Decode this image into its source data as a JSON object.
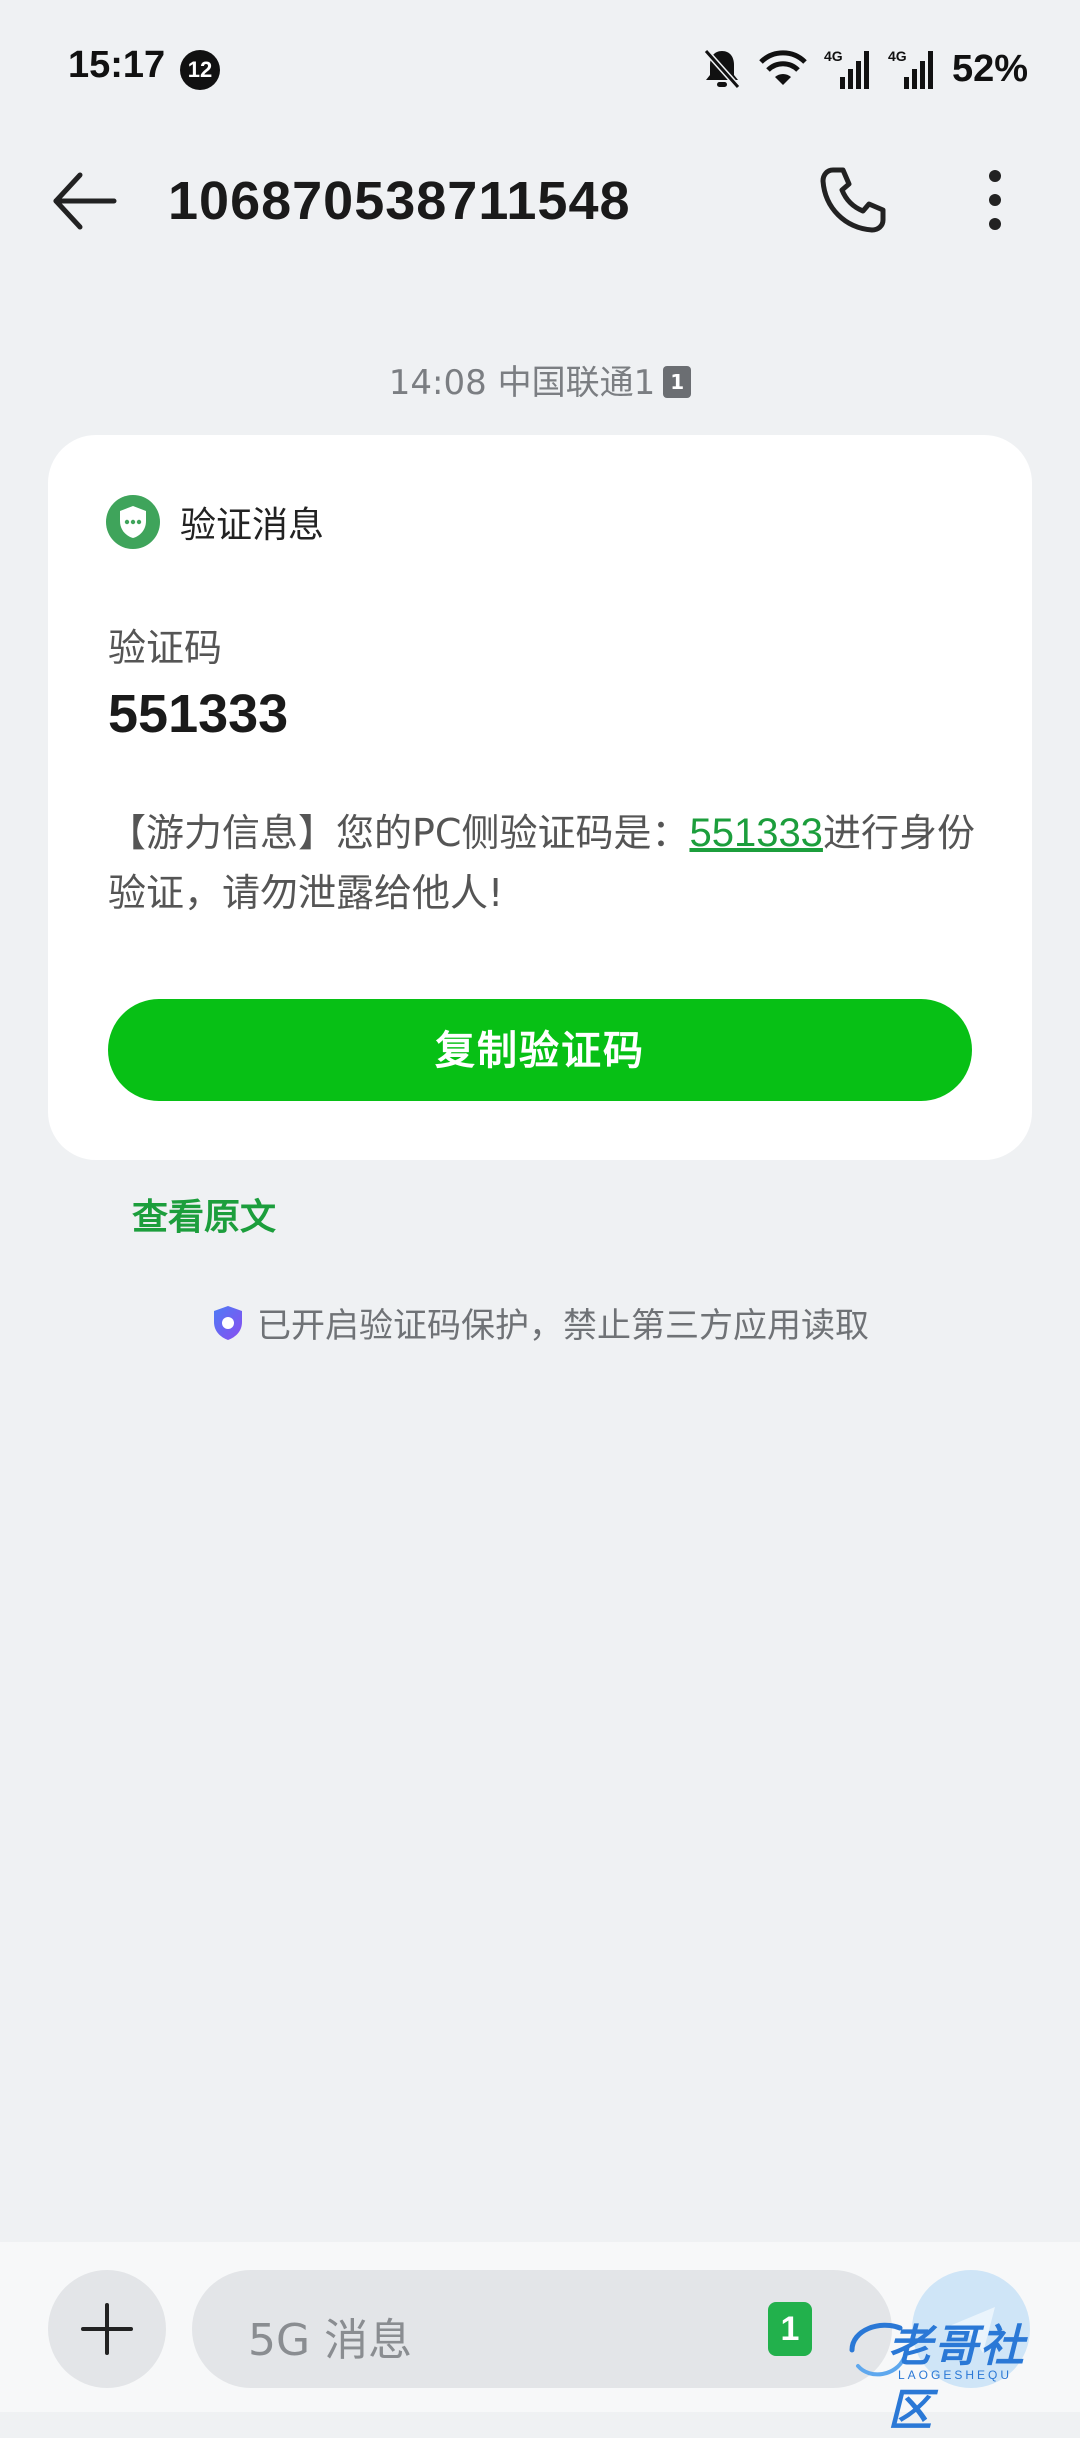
{
  "status_bar": {
    "time": "15:17",
    "notification_count": "12",
    "battery": "52%",
    "network_1": "4G",
    "network_2": "4G"
  },
  "header": {
    "title": "106870538711548"
  },
  "message": {
    "timestamp": "14:08 中国联通1",
    "sim_slot": "1",
    "card_title": "验证消息",
    "code_label": "验证码",
    "code": "551333",
    "body_prefix": "【游力信息】您的PC侧验证码是：",
    "body_code": "551333",
    "body_suffix": "进行身份验证，请勿泄露给他人!",
    "copy_button": "复制验证码"
  },
  "view_original": "查看原文",
  "protection_notice": "已开启验证码保护，禁止第三方应用读取",
  "composer": {
    "placeholder": "5G 消息",
    "sim_slot": "1"
  },
  "watermark": {
    "text": "老哥社区",
    "sub": "LAOGESHEQU"
  },
  "colors": {
    "accent_green": "#07c015",
    "link_green": "#1c9e3c",
    "background": "#eff1f3",
    "card": "#ffffff"
  },
  "icons": {
    "back": "arrow-left-icon",
    "phone": "phone-icon",
    "more": "more-vertical-icon",
    "shield": "shield-chat-icon",
    "protect": "shield-protect-icon",
    "plus": "plus-icon",
    "send": "send-icon"
  }
}
